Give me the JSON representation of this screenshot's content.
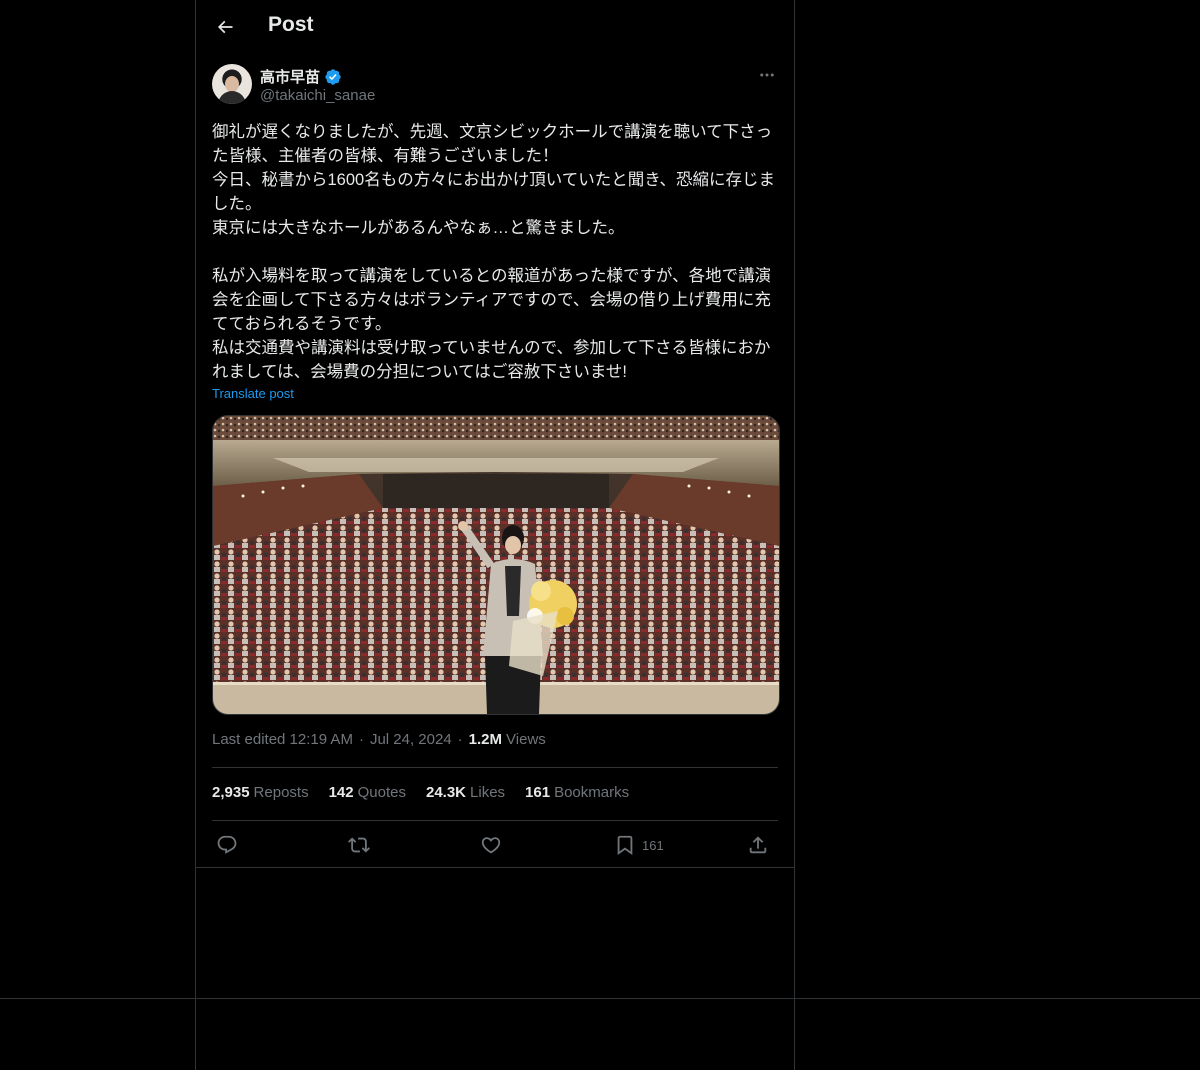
{
  "header": {
    "title": "Post",
    "back_icon": "arrow-left-icon"
  },
  "author": {
    "display_name": "高市早苗",
    "handle": "@takaichi_sanae",
    "verified": true,
    "verified_color": "#1d9bf0"
  },
  "post": {
    "text": "御礼が遅くなりましたが、先週、文京シビックホールで講演を聴いて下さった皆様、主催者の皆様、有難うございました！\n今日、秘書から1600名もの方々にお出かけ頂いていたと聞き、恐縮に存じました。\n東京には大きなホールがあるんやなぁ…と驚きました。\n\n私が入場料を取って講演をしているとの報道があった様ですが、各地で講演会を企画して下さる方々はボランティアですので、会場の借り上げ費用に充てておられるそうです。\n私は交通費や講演料は受け取っていませんので、参加して下さる皆様におかれましては、会場費の分担についてはご容赦下さいませ!",
    "translate_label": "Translate post",
    "image_alt": "Photo of a woman holding a bouquet on stage in front of a large auditorium audience"
  },
  "meta": {
    "edited_label": "Last edited 12:19 AM",
    "date": "Jul 24, 2024",
    "views_count": "1.2M",
    "views_label": "Views"
  },
  "stats": {
    "reposts_count": "2,935",
    "reposts_label": "Reposts",
    "quotes_count": "142",
    "quotes_label": "Quotes",
    "likes_count": "24.3K",
    "likes_label": "Likes",
    "bookmarks_count": "161",
    "bookmarks_label": "Bookmarks"
  },
  "actions": {
    "reply_icon": "reply-icon",
    "repost_icon": "repost-icon",
    "like_icon": "heart-icon",
    "bookmark_icon": "bookmark-icon",
    "bookmark_count": "161",
    "share_icon": "share-icon"
  },
  "colors": {
    "background": "#000000",
    "text": "#e7e9ea",
    "muted": "#71767b",
    "accent": "#1d9bf0",
    "border": "#2f3336"
  }
}
